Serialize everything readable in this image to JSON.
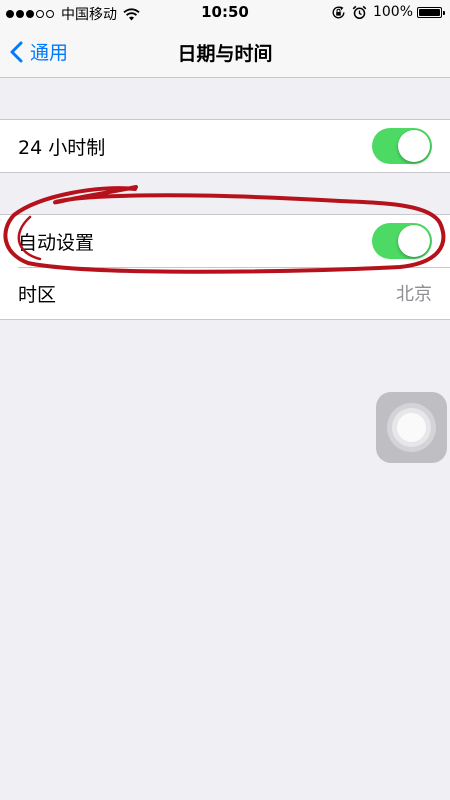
{
  "status_bar": {
    "carrier": "中国移动",
    "time": "10:50",
    "battery_percent": "100%",
    "signal_bars_filled": 3,
    "signal_bars_total": 5,
    "icons": [
      "wifi-icon",
      "orientation-lock-icon",
      "alarm-icon",
      "battery-icon"
    ]
  },
  "nav": {
    "back_label": "通用",
    "title": "日期与时间"
  },
  "settings": {
    "hour24": {
      "label": "24 小时制",
      "on": true
    },
    "auto_set": {
      "label": "自动设置",
      "on": true
    },
    "timezone": {
      "label": "时区",
      "value": "北京"
    }
  },
  "colors": {
    "accent": "#007aff",
    "toggle_on": "#4cd964",
    "background": "#efeff4",
    "annotation": "#b5121b"
  }
}
